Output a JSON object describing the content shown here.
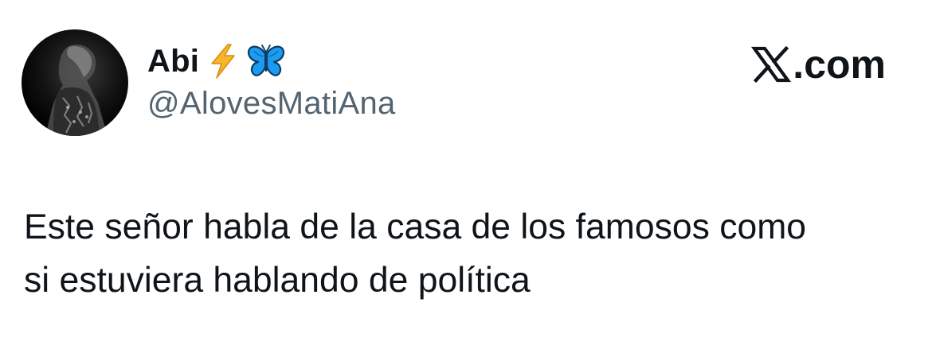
{
  "author": {
    "display_name": "Abi",
    "emojis": [
      "high-voltage-emoji",
      "blue-butterfly-emoji"
    ],
    "handle": "@AlovesMatiAna"
  },
  "brand": {
    "icon": "x-logo-icon",
    "domain": ".com"
  },
  "tweet": {
    "text": "Este señor habla de la casa de los famosos como\nsi estuviera hablando de política"
  },
  "colors": {
    "text_primary": "#0f1419",
    "text_secondary": "#536471",
    "bolt": "#f6b52a",
    "butterfly": "#1d9bf0"
  }
}
